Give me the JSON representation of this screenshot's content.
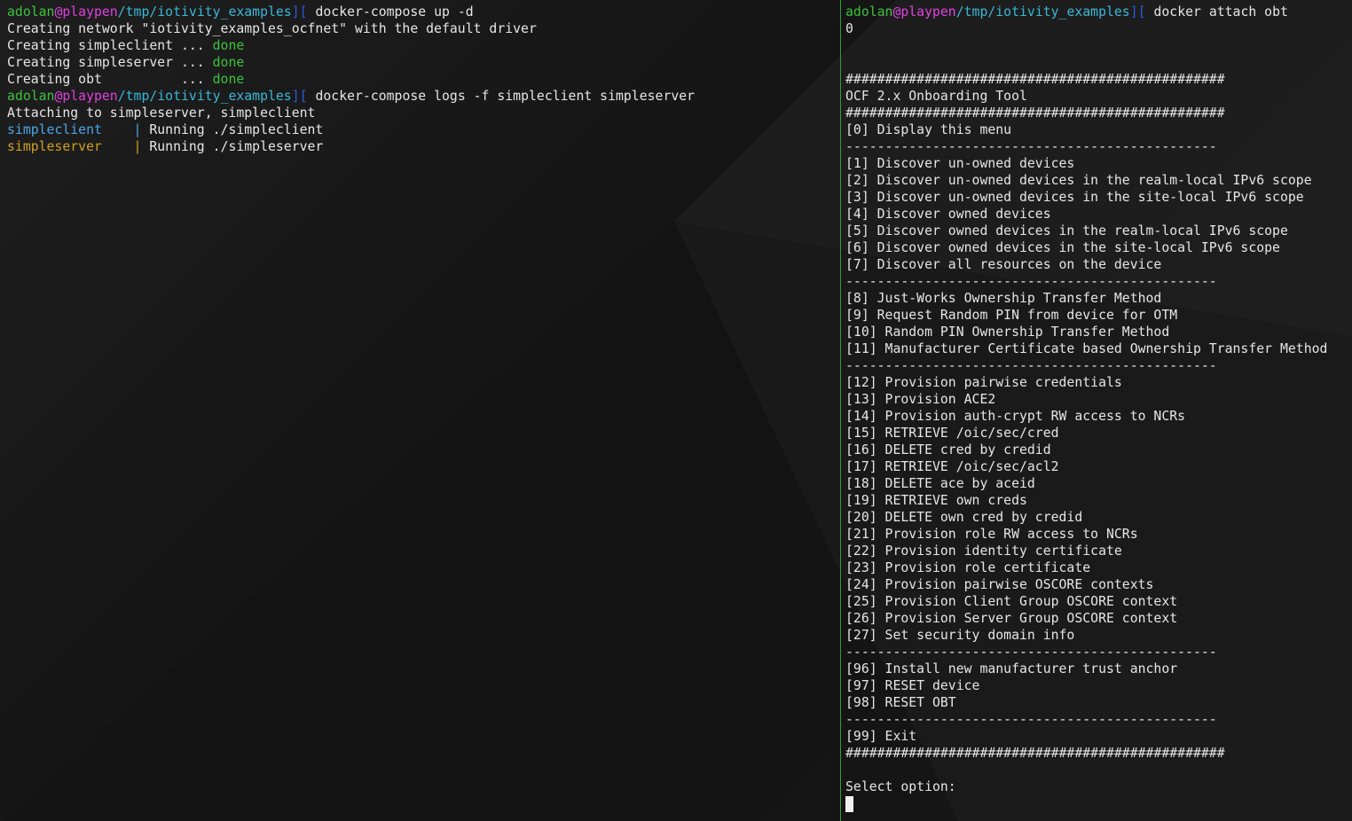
{
  "colors": {
    "user": "#3cc23c",
    "at_host": "#e040e0",
    "path": "#3ab8d8",
    "prompt_symbol": "#2a5ad8",
    "done": "#3cc23c",
    "simpleclient": "#4aa6e8",
    "simpleserver": "#d0a020",
    "divider": "#2f9e3b"
  },
  "prompt": {
    "user": "adolan",
    "at_host": "@playpen",
    "path": "/tmp/iotivity_examples",
    "symbol": "][ "
  },
  "left": {
    "cmd1": "docker-compose up -d",
    "line2": "Creating network \"iotivity_examples_ocfnet\" with the default driver",
    "line3_pre": "Creating simpleclient ... ",
    "line4_pre": "Creating simpleserver ... ",
    "line5_pre": "Creating obt          ... ",
    "done": "done",
    "cmd2": "docker-compose logs -f simpleclient simpleserver",
    "line7": "Attaching to simpleserver, simpleclient",
    "client_name": "simpleclient    | ",
    "client_msg": "Running ./simpleclient",
    "server_name": "simpleserver    | ",
    "server_msg": "Running ./simpleserver"
  },
  "right": {
    "cmd": "docker attach obt",
    "zero": "0",
    "hashes": "################################################",
    "title": "OCF 2.x Onboarding Tool",
    "sep": "-----------------------------------------------",
    "items": [
      "[0] Display this menu",
      "[1] Discover un-owned devices",
      "[2] Discover un-owned devices in the realm-local IPv6 scope",
      "[3] Discover un-owned devices in the site-local IPv6 scope",
      "[4] Discover owned devices",
      "[5] Discover owned devices in the realm-local IPv6 scope",
      "[6] Discover owned devices in the site-local IPv6 scope",
      "[7] Discover all resources on the device",
      "[8] Just-Works Ownership Transfer Method",
      "[9] Request Random PIN from device for OTM",
      "[10] Random PIN Ownership Transfer Method",
      "[11] Manufacturer Certificate based Ownership Transfer Method",
      "[12] Provision pairwise credentials",
      "[13] Provision ACE2",
      "[14] Provision auth-crypt RW access to NCRs",
      "[15] RETRIEVE /oic/sec/cred",
      "[16] DELETE cred by credid",
      "[17] RETRIEVE /oic/sec/acl2",
      "[18] DELETE ace by aceid",
      "[19] RETRIEVE own creds",
      "[20] DELETE own cred by credid",
      "[21] Provision role RW access to NCRs",
      "[22] Provision identity certificate",
      "[23] Provision role certificate",
      "[24] Provision pairwise OSCORE contexts",
      "[25] Provision Client Group OSCORE context",
      "[26] Provision Server Group OSCORE context",
      "[27] Set security domain info",
      "[96] Install new manufacturer trust anchor",
      "[97] RESET device",
      "[98] RESET OBT",
      "[99] Exit"
    ],
    "select_prompt": "Select option:"
  }
}
